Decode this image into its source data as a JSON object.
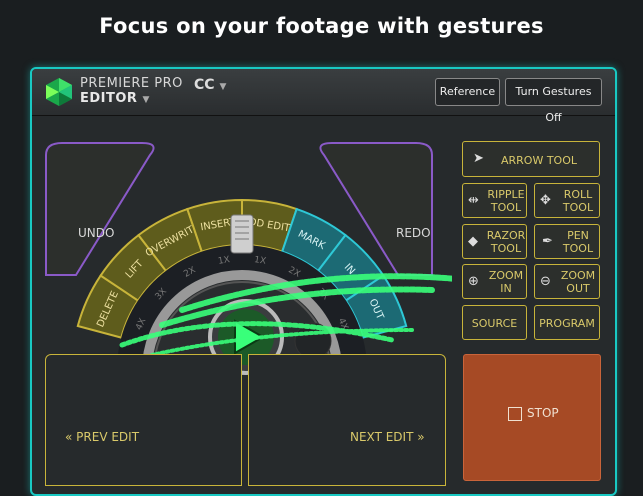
{
  "headline": "Focus on your footage with gestures",
  "app": {
    "brand_line1": "PREMIERE PRO",
    "brand_line2": "EDITOR",
    "version": "CC"
  },
  "toolbar": {
    "reference": "Reference",
    "gestures": "Turn Gestures Off"
  },
  "wheel": {
    "undo": "UNDO",
    "redo": "REDO",
    "segments": [
      "DELETE",
      "LIFT",
      "OVERWRITE",
      "INSERT",
      "ADD EDIT",
      "MARK",
      "IN",
      "OUT"
    ],
    "speeds": [
      "4X",
      "3X",
      "2X",
      "1X",
      "1X",
      "2X",
      "3X",
      "4X"
    ]
  },
  "tools": {
    "arrow": "ARROW TOOL",
    "ripple": "RIPPLE TOOL",
    "roll": "ROLL TOOL",
    "razor": "RAZOR TOOL",
    "pen": "PEN TOOL",
    "zoom_in": "ZOOM IN",
    "zoom_out": "ZOOM OUT",
    "source": "SOURCE",
    "program": "PROGRAM",
    "stop": "STOP"
  },
  "edit": {
    "prev": "« PREV EDIT",
    "next": "NEXT EDIT »"
  },
  "colors": {
    "accent_teal": "#19c9c3",
    "gold": "#c8b43a",
    "purple": "#8a5ac8",
    "green": "#39ff7a",
    "stop_orange": "#a64a25"
  },
  "icons": [
    "logo-icon",
    "arrow-cursor-icon",
    "ripple-icon",
    "roll-icon",
    "razor-icon",
    "pen-icon",
    "zoom-in-icon",
    "zoom-out-icon",
    "play-icon",
    "checkbox-icon",
    "chevron-down-icon"
  ]
}
